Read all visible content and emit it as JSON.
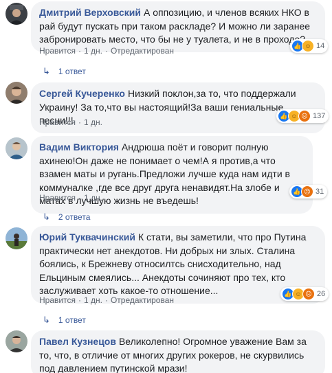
{
  "colors": {
    "link_blue": "#385898",
    "bubble_bg": "#f2f3f5",
    "meta_gray": "#606770"
  },
  "comments": [
    {
      "author": "Дмитрий Верховский",
      "text": "А оппозицию, и членов всяких НКО в рай будут пускать при таком раскладе? И можно ли заранее забронировать место, что бы не у туалета, и не в проходе?",
      "like": "Нравится",
      "time": "1 дн.",
      "edited": "Отредактирован",
      "reactions": [
        "like-icon",
        "haha-icon"
      ],
      "reaction_count": "14",
      "replies": "1 ответ"
    },
    {
      "author": "Сергей Кучеренко",
      "text": "Низкий поклон,за то, что поддержали Украину! За то,что вы настоящий!За ваши гениальные песни!!!",
      "like": "Нравится",
      "time": "1 дн.",
      "reactions": [
        "like-icon",
        "haha-icon",
        "angry-icon"
      ],
      "reaction_count": "137"
    },
    {
      "author": "Вадим Виктория",
      "text": "Андрюша поёт и говорит полную ахинею!Он даже не понимает о чем!А я против,а что взамен маты и ругань.Предложи лучше куда нам идти в коммуналке ,где все друг друга ненавидят.На злобе и матах в лучшую жизнь не въедешь!",
      "like": "Нравится",
      "time": "1 дн.",
      "reactions": [
        "like-icon",
        "angry-icon"
      ],
      "reaction_count": "31",
      "replies": "2 ответа"
    },
    {
      "author": "Юрий Туквачинский",
      "text": "К стати, вы заметили, что про Путина практически нет анекдотов. Ни добрых ни злых. Сталина боялись, к Брежневу относилтсь снисходительно, над Ельциным смеялись... Анекдоты сочиняют про тех, кто заслуживает хоть какое-то отношение...",
      "like": "Нравится",
      "time": "1 дн.",
      "edited": "Отредактирован",
      "reactions": [
        "like-icon",
        "haha-icon",
        "angry-icon"
      ],
      "reaction_count": "26",
      "replies": "1 ответ"
    },
    {
      "author": "Павел Кузнецов",
      "text": "Великолепно! Огромное уважение Вам за то, что, в отличие от многих других рокеров, не скурвились под давлением путинской мрази!"
    }
  ]
}
